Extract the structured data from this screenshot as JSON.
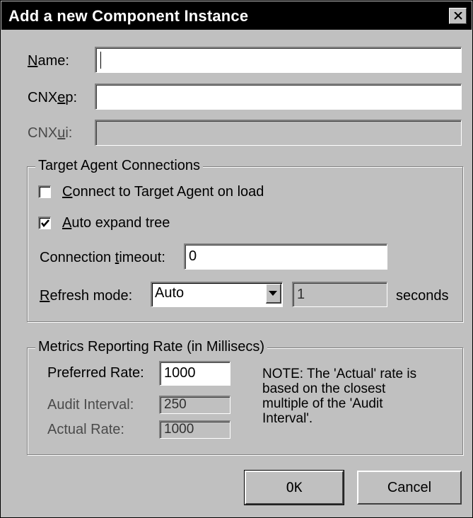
{
  "window": {
    "title": "Add a new Component Instance",
    "close_glyph": "×"
  },
  "fields": {
    "name": {
      "label_accel": "N",
      "label_rest": "ame:",
      "value": ""
    },
    "cnxep": {
      "label_pre": "CNX",
      "label_accel": "e",
      "label_rest": "p:",
      "value": ""
    },
    "cnxui": {
      "label_pre": "CNX",
      "label_accel": "u",
      "label_rest": "i:",
      "value": ""
    }
  },
  "target_agent": {
    "group_title": "Target Agent Connections",
    "connect_on_load": {
      "label_accel": "C",
      "label_rest": "onnect to Target Agent on load",
      "checked": false
    },
    "auto_expand": {
      "label_accel": "A",
      "label_rest": "uto expand tree",
      "checked": true
    },
    "timeout": {
      "label_pre": "Connection ",
      "label_accel": "t",
      "label_rest": "imeout:",
      "value": "0"
    },
    "refresh": {
      "label_accel": "R",
      "label_rest": "efresh mode:",
      "selected": "Auto",
      "interval": "1",
      "unit": "seconds"
    }
  },
  "metrics": {
    "group_title": "Metrics Reporting Rate (in Millisecs)",
    "preferred_label": "Preferred Rate:",
    "preferred_value": "1000",
    "audit_label": "Audit Interval:",
    "audit_value": "250",
    "actual_label": "Actual Rate:",
    "actual_value": "1000",
    "note_lines": [
      "NOTE: The 'Actual' rate is",
      "based on the closest",
      "multiple of the 'Audit",
      "Interval'."
    ]
  },
  "buttons": {
    "ok": "OK",
    "cancel": "Cancel"
  },
  "icons": {
    "close": "close-icon",
    "check": "checkmark-icon",
    "dropdown": "chevron-down-icon"
  }
}
